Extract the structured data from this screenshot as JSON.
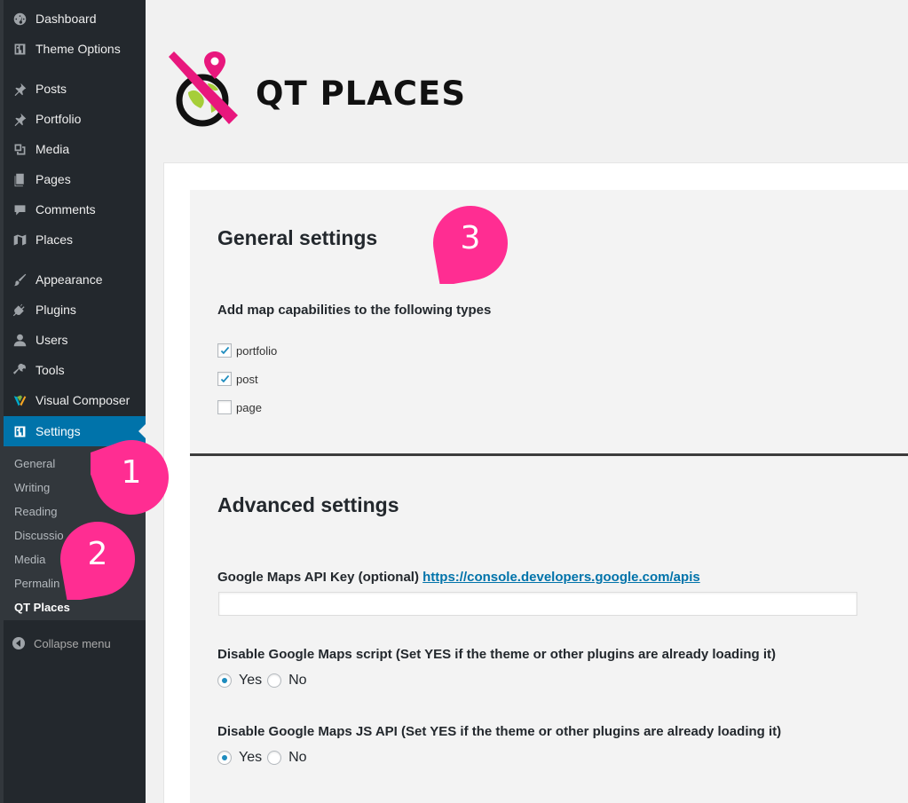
{
  "sidebar": {
    "items": [
      {
        "label": "Dashboard",
        "icon": "dashboard-icon"
      },
      {
        "label": "Theme Options",
        "icon": "theme-options-icon"
      },
      {
        "label": "Posts",
        "icon": "pin-icon"
      },
      {
        "label": "Portfolio",
        "icon": "pin-icon"
      },
      {
        "label": "Media",
        "icon": "media-icon"
      },
      {
        "label": "Pages",
        "icon": "pages-icon"
      },
      {
        "label": "Comments",
        "icon": "comment-icon"
      },
      {
        "label": "Places",
        "icon": "map-icon"
      },
      {
        "label": "Appearance",
        "icon": "brush-icon"
      },
      {
        "label": "Plugins",
        "icon": "plugin-icon"
      },
      {
        "label": "Users",
        "icon": "user-icon"
      },
      {
        "label": "Tools",
        "icon": "wrench-icon"
      },
      {
        "label": "Visual Composer",
        "icon": "visual-composer-icon"
      },
      {
        "label": "Settings",
        "icon": "settings-icon"
      }
    ],
    "submenu": [
      "General",
      "Writing",
      "Reading",
      "Discussio",
      "Media",
      "Permalin",
      "QT Places"
    ],
    "collapse_label": "Collapse menu"
  },
  "logo": {
    "text": "QT PLACES"
  },
  "general": {
    "heading": "General settings",
    "types_label": "Add map capabilities to the following types",
    "checkboxes": [
      {
        "label": "portfolio",
        "checked": true
      },
      {
        "label": "post",
        "checked": true
      },
      {
        "label": "page",
        "checked": false
      }
    ]
  },
  "advanced": {
    "heading": "Advanced settings",
    "api_key_label": "Google Maps API Key (optional)",
    "api_key_link": "https://console.developers.google.com/apis",
    "api_key_value": "",
    "script_label": "Disable Google Maps script (Set YES if the theme or other plugins are already loading it)",
    "jsapi_label": "Disable Google Maps JS API (Set YES if the theme or other plugins are already loading it)",
    "yes_label": "Yes",
    "no_label": "No",
    "script_value": "Yes",
    "jsapi_value": "Yes"
  },
  "callouts": [
    "1",
    "2",
    "3"
  ],
  "colors": {
    "accent": "#0073aa",
    "callout": "#ff2d92",
    "sidebar": "#23282d",
    "logo_pink": "#e8177d",
    "logo_green": "#a6ce39"
  }
}
